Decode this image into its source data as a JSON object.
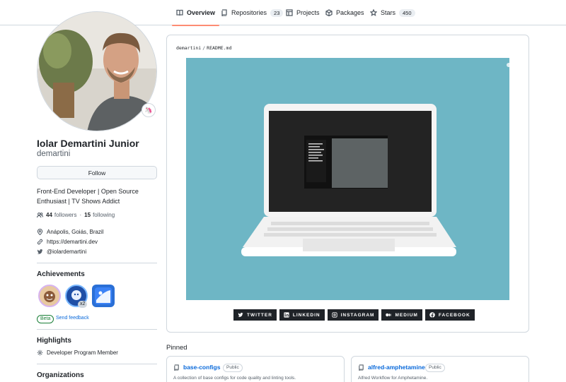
{
  "nav": {
    "tabs": [
      {
        "label": "Overview",
        "icon": "book-icon",
        "active": true
      },
      {
        "label": "Repositories",
        "icon": "repo-icon",
        "count": "23"
      },
      {
        "label": "Projects",
        "icon": "project-icon"
      },
      {
        "label": "Packages",
        "icon": "package-icon"
      },
      {
        "label": "Stars",
        "icon": "star-icon",
        "count": "450"
      }
    ]
  },
  "profile": {
    "full_name": "Iolar Demartini Junior",
    "username": "demartini",
    "follow_label": "Follow",
    "bio": "Front-End Developer | Open Source Enthusiast | TV Shows Addict",
    "followers_count": "44",
    "followers_label": "followers",
    "separator": "·",
    "following_count": "15",
    "following_label": "following",
    "location": "Anápolis, Goiás, Brazil",
    "website": "https://demartini.dev",
    "twitter": "@iolardemartini",
    "status_emoji": "🦄"
  },
  "achievements": {
    "title": "Achievements",
    "badges": [
      {
        "name": "achievement-badge-1"
      },
      {
        "name": "achievement-badge-2",
        "multiplier": "x2"
      },
      {
        "name": "achievement-badge-3"
      }
    ],
    "beta_label": "Beta",
    "feedback_label": "Send feedback"
  },
  "highlights": {
    "title": "Highlights",
    "items": [
      "Developer Program Member"
    ]
  },
  "organizations": {
    "title": "Organizations"
  },
  "readme": {
    "path_owner": "demartini",
    "path_sep": "/",
    "path_file": "README.md",
    "banner_color": "#6eb6c5",
    "social_buttons": [
      {
        "label": "TWITTER",
        "icon": "twitter-icon"
      },
      {
        "label": "LINKEDIN",
        "icon": "linkedin-icon"
      },
      {
        "label": "INSTAGRAM",
        "icon": "instagram-icon"
      },
      {
        "label": "MEDIUM",
        "icon": "medium-icon"
      },
      {
        "label": "FACEBOOK",
        "icon": "facebook-icon"
      }
    ]
  },
  "pinned": {
    "title": "Pinned",
    "repos": [
      {
        "name": "base-configs",
        "visibility": "Public",
        "description": "A collection of base configs for code quality and linting tools."
      },
      {
        "name": "alfred-amphetamine",
        "visibility": "Public",
        "description": "Alfred Workflow for Amphetamine."
      }
    ]
  },
  "colors": {
    "accent": "#fd8c73",
    "link": "#0969da",
    "border": "#d0d7de"
  }
}
